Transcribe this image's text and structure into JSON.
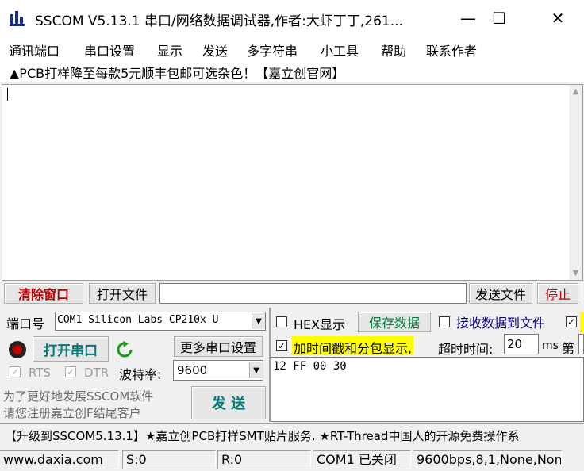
{
  "window": {
    "title": "SSCOM V5.13.1 串口/网络数据调试器,作者:大虾丁丁,261...",
    "minimize": "—",
    "maximize": "☐",
    "close": "✕"
  },
  "menu": [
    "通讯端口",
    "串口设置",
    "显示",
    "发送",
    "多字符串",
    "小工具",
    "帮助",
    "联系作者"
  ],
  "ad_banner": "▲PCB打样降至每款5元顺丰包邮可选杂色！【嘉立创官网】",
  "receive": {
    "text": ""
  },
  "toolbar": {
    "clear_window": "清除窗口",
    "open_file": "打开文件",
    "file_path": "",
    "send_file": "发送文件",
    "stop": "停止"
  },
  "port": {
    "label": "端口号",
    "value": "COM1 Silicon Labs CP210x U",
    "open_button": "打开串口",
    "more_settings": "更多串口设置",
    "rts_label": "RTS",
    "dtr_label": "DTR",
    "baud_label": "波特率:",
    "baud_value": "9600",
    "promo_line1": "为了更好地发展SSCOM软件",
    "promo_line2": "请您注册嘉立创F结尾客户",
    "send_button": "发  送"
  },
  "options": {
    "hex_display": "HEX显示",
    "save_data": "保存数据",
    "receive_to_file": "接收数据到文件",
    "add_timestamp": "加时间戳和分包显示,",
    "timeout_label": "超时时间:",
    "timeout_value": "20",
    "timeout_unit": "ms",
    "nth_label": "第"
  },
  "send_box": {
    "text": "12 FF 00 30"
  },
  "ticker": "【升级到SSCOM5.13.1】★嘉立创PCB打样SMT贴片服务. ★RT-Thread中国人的开源免费操作系",
  "status": {
    "website": "www.daxia.com",
    "sent": "S:0",
    "received": "R:0",
    "port_state": "COM1 已关闭",
    "params": "9600bps,8,1,None,None"
  },
  "colors": {
    "timestamp_highlight": "#ffff00",
    "accent_red": "#c00000",
    "accent_teal": "#007a7a"
  }
}
